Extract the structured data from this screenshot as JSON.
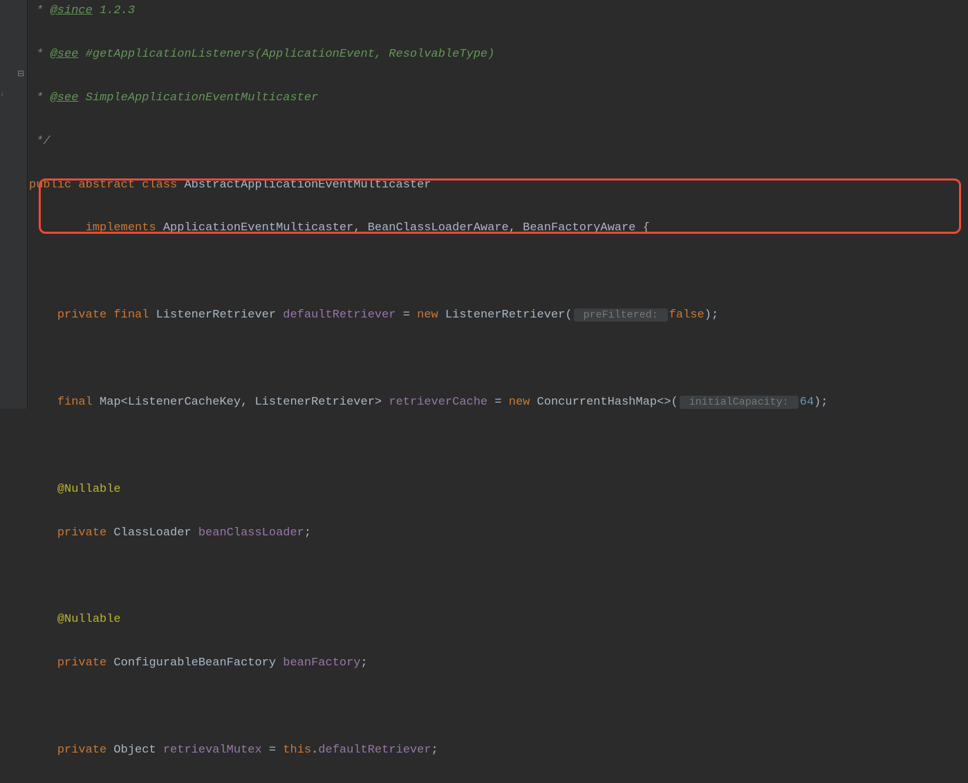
{
  "gutter": {
    "fold_icon": "⊟",
    "arrow_icon": "↓"
  },
  "code": {
    "l1": {
      "prefix": " * ",
      "tag": "@since",
      "rest": " 1.2.3"
    },
    "l2": {
      "prefix": " * ",
      "tag": "@see",
      "rest": " #getApplicationListeners(ApplicationEvent, ResolvableType)"
    },
    "l3": {
      "prefix": " * ",
      "tag": "@see",
      "rest": " SimpleApplicationEventMulticaster"
    },
    "l4": {
      "prefix": " */"
    },
    "l5": {
      "kw1": "public abstract class",
      "type": " AbstractApplicationEventMulticaster"
    },
    "l6": {
      "kw": "implements",
      "types": " ApplicationEventMulticaster, BeanClassLoaderAware, BeanFactoryAware {"
    },
    "l7": {
      "kw1": "private final",
      "type1": " ListenerRetriever ",
      "field": "defaultRetriever",
      "eq": " = ",
      "kw2": "new",
      "type2": " ListenerRetriever(",
      "hint": " preFiltered: ",
      "kw3": "false",
      "end": ");"
    },
    "l8": {
      "kw1": "final",
      "type1": " Map<ListenerCacheKey, ListenerRetriever> ",
      "field": "retrieverCache",
      "eq": " = ",
      "kw2": "new",
      "type2": " ConcurrentHashMap<>(",
      "hint": " initialCapacity: ",
      "num": "64",
      "end": ");"
    },
    "l9": {
      "ann": "@Nullable"
    },
    "l10": {
      "kw": "private",
      "type": " ClassLoader ",
      "field": "beanClassLoader",
      "end": ";"
    },
    "l11": {
      "ann": "@Nullable"
    },
    "l12": {
      "kw": "private",
      "type": " ConfigurableBeanFactory ",
      "field": "beanFactory",
      "end": ";"
    },
    "l13": {
      "kw": "private",
      "type": " Object ",
      "field": "retrievalMutex",
      "eq": " = ",
      "kw2": "this",
      "dot": ".",
      "field2": "defaultRetriever",
      "end": ";"
    }
  }
}
